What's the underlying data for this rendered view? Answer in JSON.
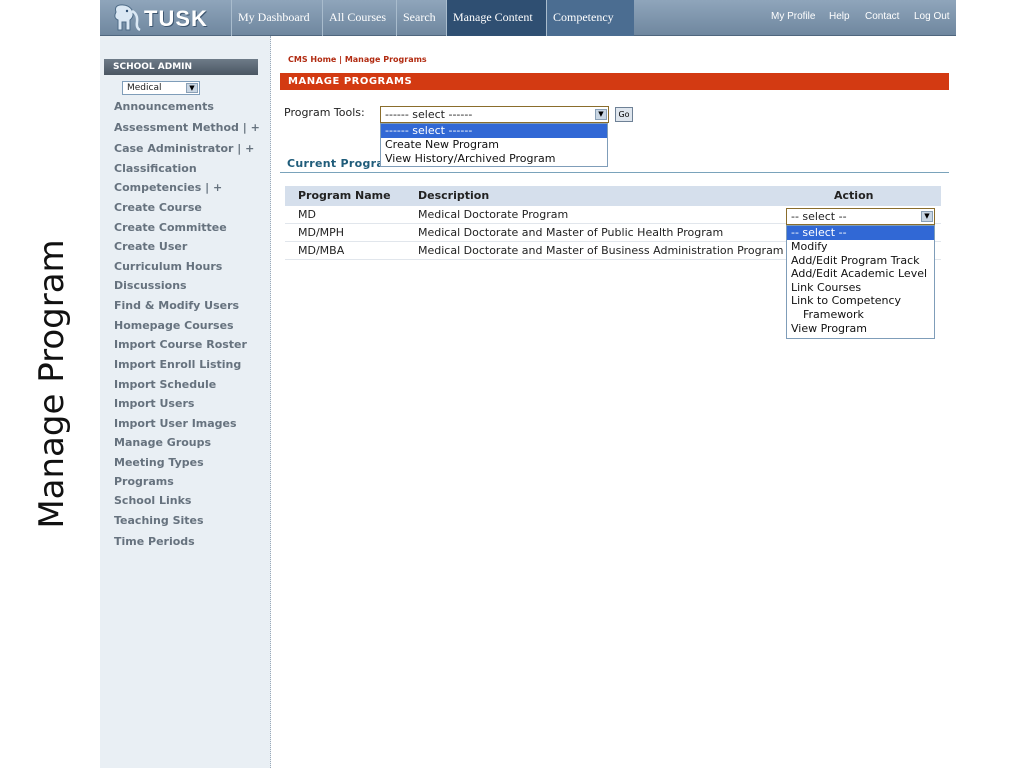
{
  "slide_caption": "Manage Program",
  "header": {
    "logo_text": "TUSK",
    "tabs": [
      {
        "label": "My Dashboard",
        "active": false
      },
      {
        "label": "All Courses",
        "active": false
      },
      {
        "label": "Search",
        "active": false
      },
      {
        "label": "Manage Content",
        "active": true
      },
      {
        "label": "Competency",
        "active": false
      }
    ],
    "util_links": [
      "My Profile",
      "Help",
      "Contact",
      "Log Out"
    ]
  },
  "sidebar": {
    "header": "SCHOOL ADMIN",
    "school_select": "Medical",
    "items": [
      "Announcements",
      "Assessment Method  | +",
      "Case Administrator  | +",
      "Classification",
      "Competencies  | +",
      "Create Course",
      "Create Committee",
      "Create User",
      "Curriculum Hours",
      "Discussions",
      "Find & Modify Users",
      "Homepage Courses",
      "Import Course Roster",
      "Import Enroll Listing",
      "Import Schedule",
      "Import Users",
      "Import User Images",
      "Manage Groups",
      "Meeting Types",
      "Programs",
      "School Links",
      "Teaching Sites",
      "Time Periods"
    ]
  },
  "main": {
    "breadcrumb": "CMS Home | Manage Programs",
    "section_title": "MANAGE PROGRAMS",
    "program_tools": {
      "label": "Program Tools:",
      "selected": "------ select ------",
      "go_label": "Go",
      "options": [
        "------ select ------",
        "Create New Program",
        "View History/Archived Program"
      ]
    },
    "current_title": "Current Programs",
    "table": {
      "headers": [
        "Program Name",
        "Description",
        "Action"
      ],
      "rows": [
        {
          "name": "MD",
          "description": "Medical Doctorate Program"
        },
        {
          "name": "MD/MPH",
          "description": "Medical Doctorate and Master of Public Health Program"
        },
        {
          "name": "MD/MBA",
          "description": "Medical Doctorate and Master of Business Administration Program"
        }
      ]
    },
    "action_select": {
      "selected": "-- select --",
      "options": [
        "-- select --",
        "Modify",
        "Add/Edit Program Track",
        "Add/Edit Academic Level",
        "Link Courses",
        "Link to Competency",
        "Framework",
        "View Program"
      ]
    }
  },
  "colors": {
    "nav_bar": "#7b93aa",
    "active_tab": "#2f4f72",
    "section_bar": "#d33a12",
    "sidebar_bg": "#e9eff4",
    "table_header": "#d5dfec",
    "dropdown_highlight": "#3168d5"
  },
  "icons": [
    "tusk-elephant-logo",
    "select-arrow-icon"
  ]
}
